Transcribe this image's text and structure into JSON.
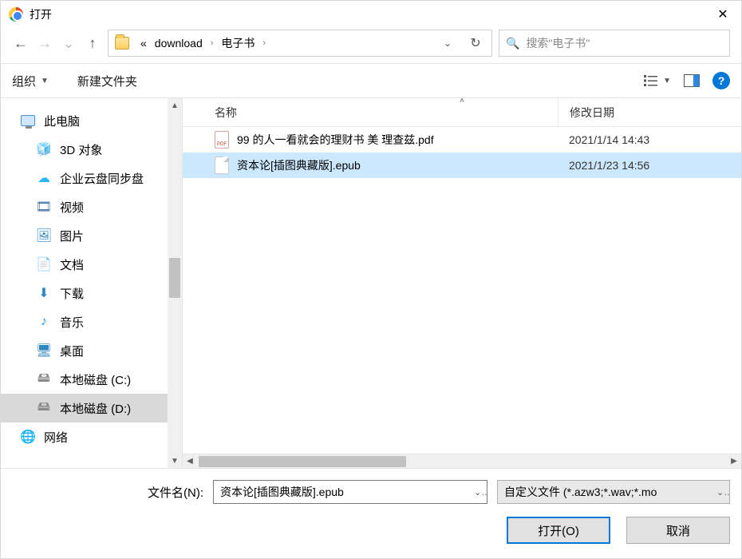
{
  "title": "打开",
  "nav": {
    "path_prefix": "«",
    "path1": "download",
    "path2": "电子书"
  },
  "search": {
    "placeholder": "搜索\"电子书\""
  },
  "toolbar": {
    "organize": "组织",
    "newfolder": "新建文件夹"
  },
  "sidebar": {
    "items": [
      {
        "id": "this-pc",
        "label": "此电脑",
        "icon": "monitor",
        "level": 1
      },
      {
        "id": "3d",
        "label": "3D 对象",
        "icon": "cube",
        "level": 2
      },
      {
        "id": "cloud",
        "label": "企业云盘同步盘",
        "icon": "cloud",
        "level": 2
      },
      {
        "id": "video",
        "label": "视频",
        "icon": "film",
        "level": 2
      },
      {
        "id": "pics",
        "label": "图片",
        "icon": "picture",
        "level": 2
      },
      {
        "id": "docs",
        "label": "文档",
        "icon": "doc",
        "level": 2
      },
      {
        "id": "downloads",
        "label": "下载",
        "icon": "download",
        "level": 2
      },
      {
        "id": "music",
        "label": "音乐",
        "icon": "music",
        "level": 2
      },
      {
        "id": "desktop",
        "label": "桌面",
        "icon": "desktop",
        "level": 2
      },
      {
        "id": "drive-c",
        "label": "本地磁盘 (C:)",
        "icon": "drive",
        "level": 2
      },
      {
        "id": "drive-d",
        "label": "本地磁盘 (D:)",
        "icon": "drive",
        "level": 2,
        "selected": true
      },
      {
        "id": "network",
        "label": "网络",
        "icon": "network",
        "level": 1
      }
    ]
  },
  "columns": {
    "name": "名称",
    "date": "修改日期"
  },
  "files": [
    {
      "name": "99 的人一看就会的理财书 美 理查兹.pdf",
      "date": "2021/1/14 14:43",
      "type": "pdf",
      "selected": false
    },
    {
      "name": "资本论[插图典藏版].epub",
      "date": "2021/1/23 14:56",
      "type": "file",
      "selected": true
    }
  ],
  "bottom": {
    "filename_label": "文件名(N):",
    "filename_value": "资本论[插图典藏版].epub",
    "type_value": "自定义文件 (*.azw3;*.wav;*.mo",
    "open": "打开(O)",
    "cancel": "取消"
  }
}
